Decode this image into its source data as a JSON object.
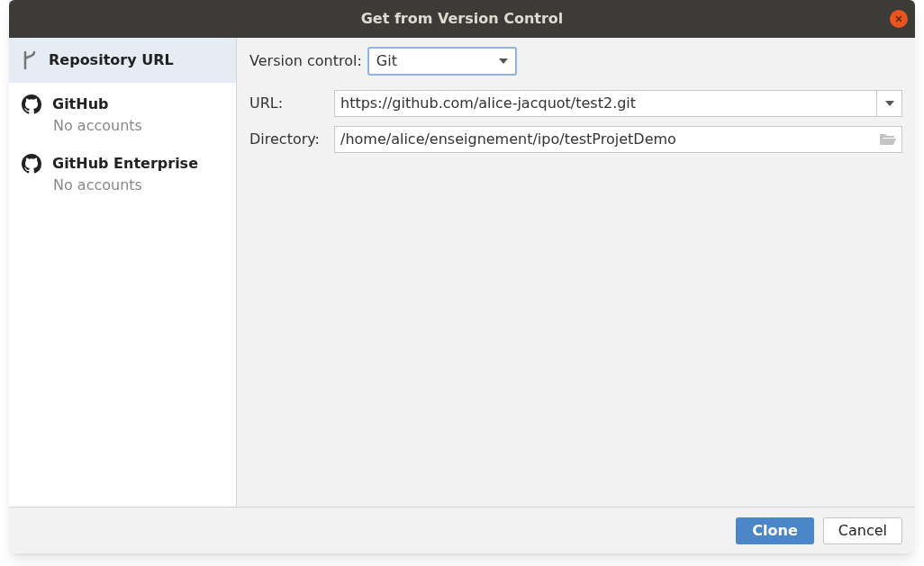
{
  "window": {
    "title": "Get from Version Control"
  },
  "sidebar": {
    "items": [
      {
        "kind": "branch",
        "label": "Repository URL",
        "selected": true
      },
      {
        "kind": "github",
        "label": "GitHub",
        "subtitle": "No accounts",
        "selected": false
      },
      {
        "kind": "github",
        "label": "GitHub Enterprise",
        "subtitle": "No accounts",
        "selected": false
      }
    ]
  },
  "form": {
    "version_control": {
      "label": "Version control:",
      "value": "Git"
    },
    "url": {
      "label": "URL:",
      "value": "https://github.com/alice-jacquot/test2.git"
    },
    "directory": {
      "label": "Directory:",
      "value": "/home/alice/enseignement/ipo/testProjetDemo"
    }
  },
  "buttons": [
    {
      "label": "Clone",
      "kind": "primary"
    },
    {
      "label": "Cancel",
      "kind": "secondary"
    }
  ]
}
